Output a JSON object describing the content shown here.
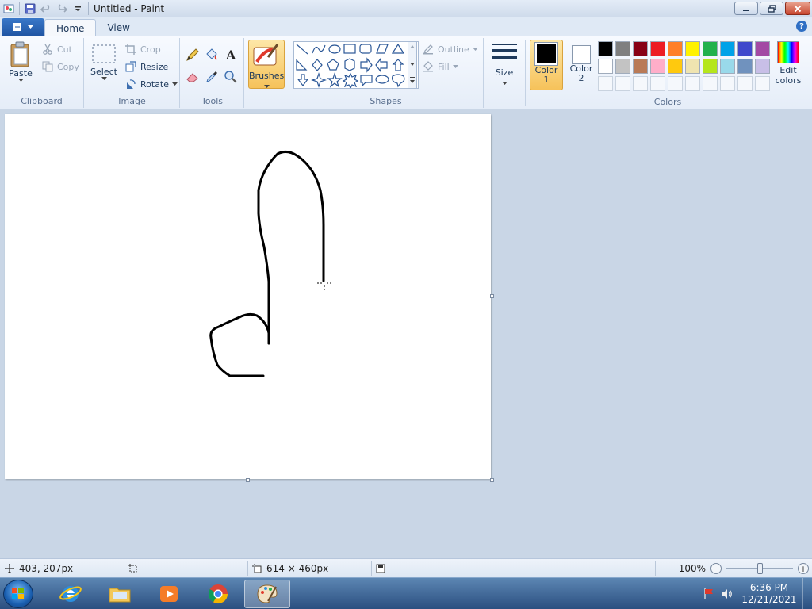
{
  "window": {
    "title": "Untitled - Paint"
  },
  "tabs": {
    "home": "Home",
    "view": "View"
  },
  "clipboard": {
    "label": "Clipboard",
    "paste": "Paste",
    "cut": "Cut",
    "copy": "Copy"
  },
  "image": {
    "label": "Image",
    "select": "Select",
    "crop": "Crop",
    "resize": "Resize",
    "rotate": "Rotate"
  },
  "tools": {
    "label": "Tools"
  },
  "brushes": {
    "label": "Brushes"
  },
  "shapes": {
    "label": "Shapes",
    "outline": "Outline",
    "fill": "Fill"
  },
  "size": {
    "label": "Size"
  },
  "colors": {
    "label": "Colors",
    "color1_line1": "Color",
    "color1_line2": "1",
    "color2_line1": "Color",
    "color2_line2": "2",
    "edit_line1": "Edit",
    "edit_line2": "colors",
    "color1_value": "#000000",
    "color2_value": "#ffffff",
    "row1": [
      "#000000",
      "#7f7f7f",
      "#880015",
      "#ed1c24",
      "#ff7f27",
      "#fff200",
      "#22b14c",
      "#00a2e8",
      "#3f48cc",
      "#a349a4"
    ],
    "row2": [
      "#ffffff",
      "#c3c3c3",
      "#b97a57",
      "#ffaec9",
      "#ffc90e",
      "#efe4b0",
      "#b5e61d",
      "#99d9ea",
      "#7092be",
      "#c8bfe7"
    ]
  },
  "status": {
    "cursor_pos": "403, 207px",
    "canvas_size": "614 × 460px",
    "zoom": "100%",
    "zoom_fraction": 0.5
  },
  "taskbar": {
    "time": "6:36 PM",
    "date": "12/21/2021"
  }
}
